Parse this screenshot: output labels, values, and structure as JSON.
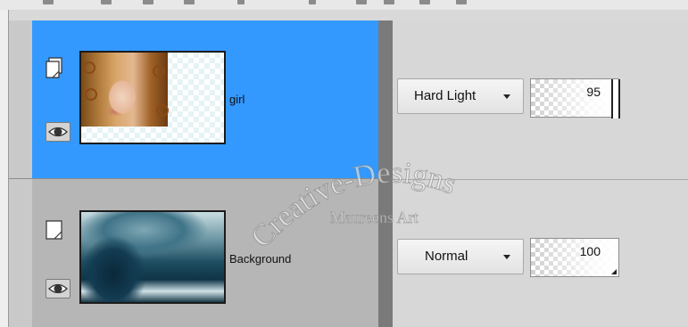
{
  "toolbar": {
    "icons": [
      "toolbar-tool-icon-1",
      "toolbar-tool-icon-2",
      "toolbar-tool-icon-3",
      "toolbar-tool-icon-4",
      "toolbar-tool-icon-5",
      "toolbar-tool-icon-6",
      "toolbar-tool-icon-7",
      "toolbar-tool-icon-8",
      "toolbar-tool-icon-9",
      "toolbar-tool-icon-10"
    ]
  },
  "layers": [
    {
      "name": "girl",
      "selected": true,
      "visible": true,
      "blend_mode": "Hard Light",
      "opacity": "95",
      "row_color": "#3399ff",
      "thumbnail": "portrait-thumbnail"
    },
    {
      "name": "Background",
      "selected": false,
      "visible": true,
      "blend_mode": "Normal",
      "opacity": "100",
      "row_color": "#b6b6b6",
      "thumbnail": "wave-thumbnail"
    }
  ],
  "watermark": {
    "line1": "Creative-Designs",
    "line2": "Maureens Art"
  },
  "icons": {
    "mask": "layer-mask-icon",
    "eye": "eye-icon",
    "dropdown": "chevron-down-icon"
  }
}
